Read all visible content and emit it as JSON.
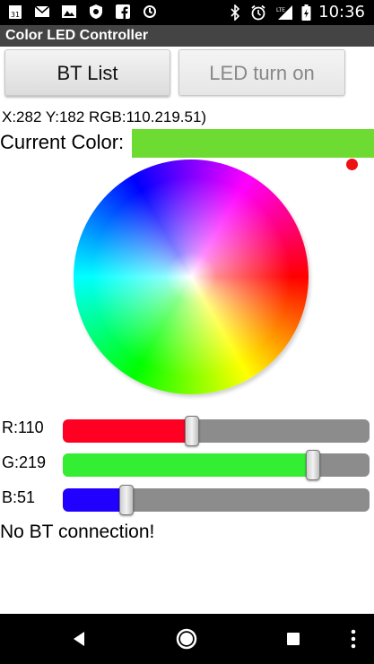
{
  "status_bar": {
    "calendar_day": "31",
    "time": "10:36",
    "network": "LTE"
  },
  "app": {
    "title": "Color LED Controller"
  },
  "buttons": {
    "bt_list": "BT List",
    "led_turn_on": "LED turn on"
  },
  "readout": "X:282 Y:182  RGB:110.219.51)",
  "current_color": {
    "label": "Current Color:",
    "swatch_hex": "#6edb33"
  },
  "color_wheel": {
    "indicator_color": "#ee1111"
  },
  "sliders": [
    {
      "label": "R:110",
      "value": 110,
      "max": 255,
      "fill_color": "#ff0022"
    },
    {
      "label": "G:219",
      "value": 219,
      "max": 255,
      "fill_color": "#33ee33"
    },
    {
      "label": "B:51",
      "value": 51,
      "max": 255,
      "fill_color": "#2200ff"
    }
  ],
  "status_message": "No BT connection!"
}
